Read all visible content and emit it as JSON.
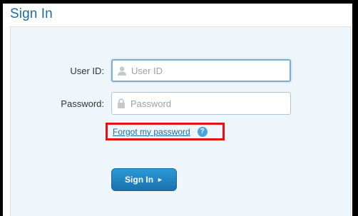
{
  "form": {
    "title": "Sign In",
    "user_id_label": "User ID:",
    "user_id_placeholder": "User ID",
    "user_id_value": "",
    "password_label": "Password:",
    "password_placeholder": "Password",
    "password_value": "",
    "forgot_label": "Forgot my password",
    "help_glyph": "?",
    "submit_label": "Sign In",
    "submit_arrow": "►"
  },
  "icons": {
    "user_field": "user-icon",
    "password_field": "lock-icon",
    "help": "help-icon"
  },
  "colors": {
    "title": "#1e6c9f",
    "panel_bg": "#eef5fb",
    "button": "#1f85c4",
    "highlight_box": "#e3111a",
    "help_icon": "#4aa3dc"
  }
}
